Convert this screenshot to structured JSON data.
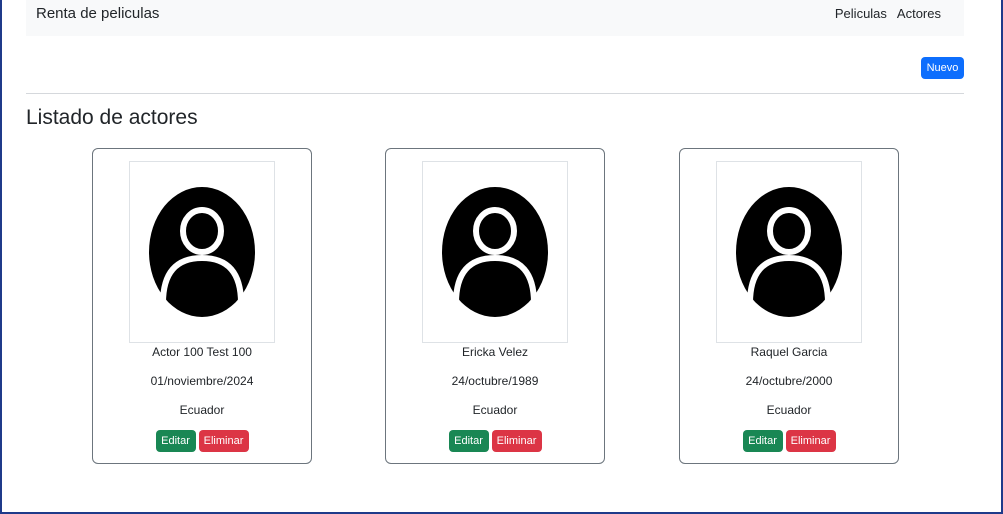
{
  "navbar": {
    "brand": "Renta de peliculas",
    "links": [
      "Peliculas",
      "Actores"
    ]
  },
  "toolbar": {
    "new_label": "Nuevo"
  },
  "page": {
    "title": "Listado de actores"
  },
  "actors": [
    {
      "name": "Actor 100 Test 100",
      "birthdate": "01/noviembre/2024",
      "country": "Ecuador"
    },
    {
      "name": "Ericka Velez",
      "birthdate": "24/octubre/1989",
      "country": "Ecuador"
    },
    {
      "name": "Raquel Garcia",
      "birthdate": "24/octubre/2000",
      "country": "Ecuador"
    }
  ],
  "card_actions": {
    "edit_label": "Editar",
    "delete_label": "Eliminar"
  },
  "colors": {
    "primary": "#0d6efd",
    "success": "#198754",
    "danger": "#dc3545",
    "navbar_bg": "#f8f9fa"
  },
  "icons": {
    "avatar": "user-avatar-icon"
  }
}
